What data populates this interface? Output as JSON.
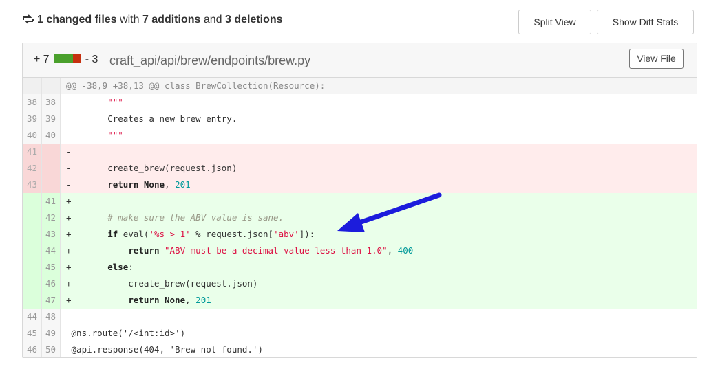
{
  "summary": {
    "changed": "1 changed files",
    "with": " with ",
    "additions": "7 additions",
    "and": " and ",
    "deletions": "3 deletions"
  },
  "buttons": {
    "split_view": "Split View",
    "show_diff_stats": "Show Diff Stats",
    "view_file": "View File"
  },
  "file": {
    "additions_label": "+ 7",
    "deletions_label": "- 3",
    "path": "craft_api/api/brew/endpoints/brew.py"
  },
  "colors": {
    "added_bar": "#4aa02c",
    "deleted_bar": "#c6300f",
    "arrow": "#1c1cdc"
  },
  "diff": {
    "hunk": "@@ -38,9 +38,13 @@ class BrewCollection(Resource):",
    "rows": [
      {
        "old": "38",
        "new": "38",
        "type": "ctx",
        "tokens": [
          [
            "plain",
            "        "
          ],
          [
            "str",
            "\"\"\""
          ]
        ]
      },
      {
        "old": "39",
        "new": "39",
        "type": "ctx",
        "tokens": [
          [
            "plain",
            "        Creates a new brew entry."
          ]
        ]
      },
      {
        "old": "40",
        "new": "40",
        "type": "ctx",
        "tokens": [
          [
            "plain",
            "        "
          ],
          [
            "str",
            "\"\"\""
          ]
        ]
      },
      {
        "old": "41",
        "new": "",
        "type": "del",
        "tokens": [
          [
            "plain",
            "-"
          ]
        ]
      },
      {
        "old": "42",
        "new": "",
        "type": "del",
        "tokens": [
          [
            "plain",
            "-       create_brew(request.json)"
          ]
        ]
      },
      {
        "old": "43",
        "new": "",
        "type": "del",
        "tokens": [
          [
            "plain",
            "-       "
          ],
          [
            "kw",
            "return"
          ],
          [
            "plain",
            " "
          ],
          [
            "kw",
            "None"
          ],
          [
            "plain",
            ", "
          ],
          [
            "numlit",
            "201"
          ]
        ]
      },
      {
        "old": "",
        "new": "41",
        "type": "add",
        "tokens": [
          [
            "plain",
            "+"
          ]
        ]
      },
      {
        "old": "",
        "new": "42",
        "type": "add",
        "tokens": [
          [
            "plain",
            "+       "
          ],
          [
            "com",
            "# make sure the ABV value is sane."
          ]
        ]
      },
      {
        "old": "",
        "new": "43",
        "type": "add",
        "tokens": [
          [
            "plain",
            "+       "
          ],
          [
            "kw",
            "if"
          ],
          [
            "plain",
            " eval("
          ],
          [
            "str",
            "'%s > 1'"
          ],
          [
            "plain",
            " % request.json["
          ],
          [
            "str",
            "'abv'"
          ],
          [
            "plain",
            "]):"
          ]
        ]
      },
      {
        "old": "",
        "new": "44",
        "type": "add",
        "tokens": [
          [
            "plain",
            "+           "
          ],
          [
            "kw",
            "return"
          ],
          [
            "plain",
            " "
          ],
          [
            "str",
            "\"ABV must be a decimal value less than 1.0\""
          ],
          [
            "plain",
            ", "
          ],
          [
            "numlit",
            "400"
          ]
        ]
      },
      {
        "old": "",
        "new": "45",
        "type": "add",
        "tokens": [
          [
            "plain",
            "+       "
          ],
          [
            "kw",
            "else"
          ],
          [
            "plain",
            ":"
          ]
        ]
      },
      {
        "old": "",
        "new": "46",
        "type": "add",
        "tokens": [
          [
            "plain",
            "+           create_brew(request.json)"
          ]
        ]
      },
      {
        "old": "",
        "new": "47",
        "type": "add",
        "tokens": [
          [
            "plain",
            "+           "
          ],
          [
            "kw",
            "return"
          ],
          [
            "plain",
            " "
          ],
          [
            "kw",
            "None"
          ],
          [
            "plain",
            ", "
          ],
          [
            "numlit",
            "201"
          ]
        ]
      },
      {
        "old": "44",
        "new": "48",
        "type": "ctx",
        "tokens": [
          [
            "plain",
            ""
          ]
        ]
      },
      {
        "old": "45",
        "new": "49",
        "type": "ctx",
        "tokens": [
          [
            "plain",
            " @ns.route('/<int:id>')"
          ]
        ]
      },
      {
        "old": "46",
        "new": "50",
        "type": "ctx",
        "tokens": [
          [
            "plain",
            " @api.response(404, 'Brew not found.')"
          ]
        ]
      }
    ]
  }
}
